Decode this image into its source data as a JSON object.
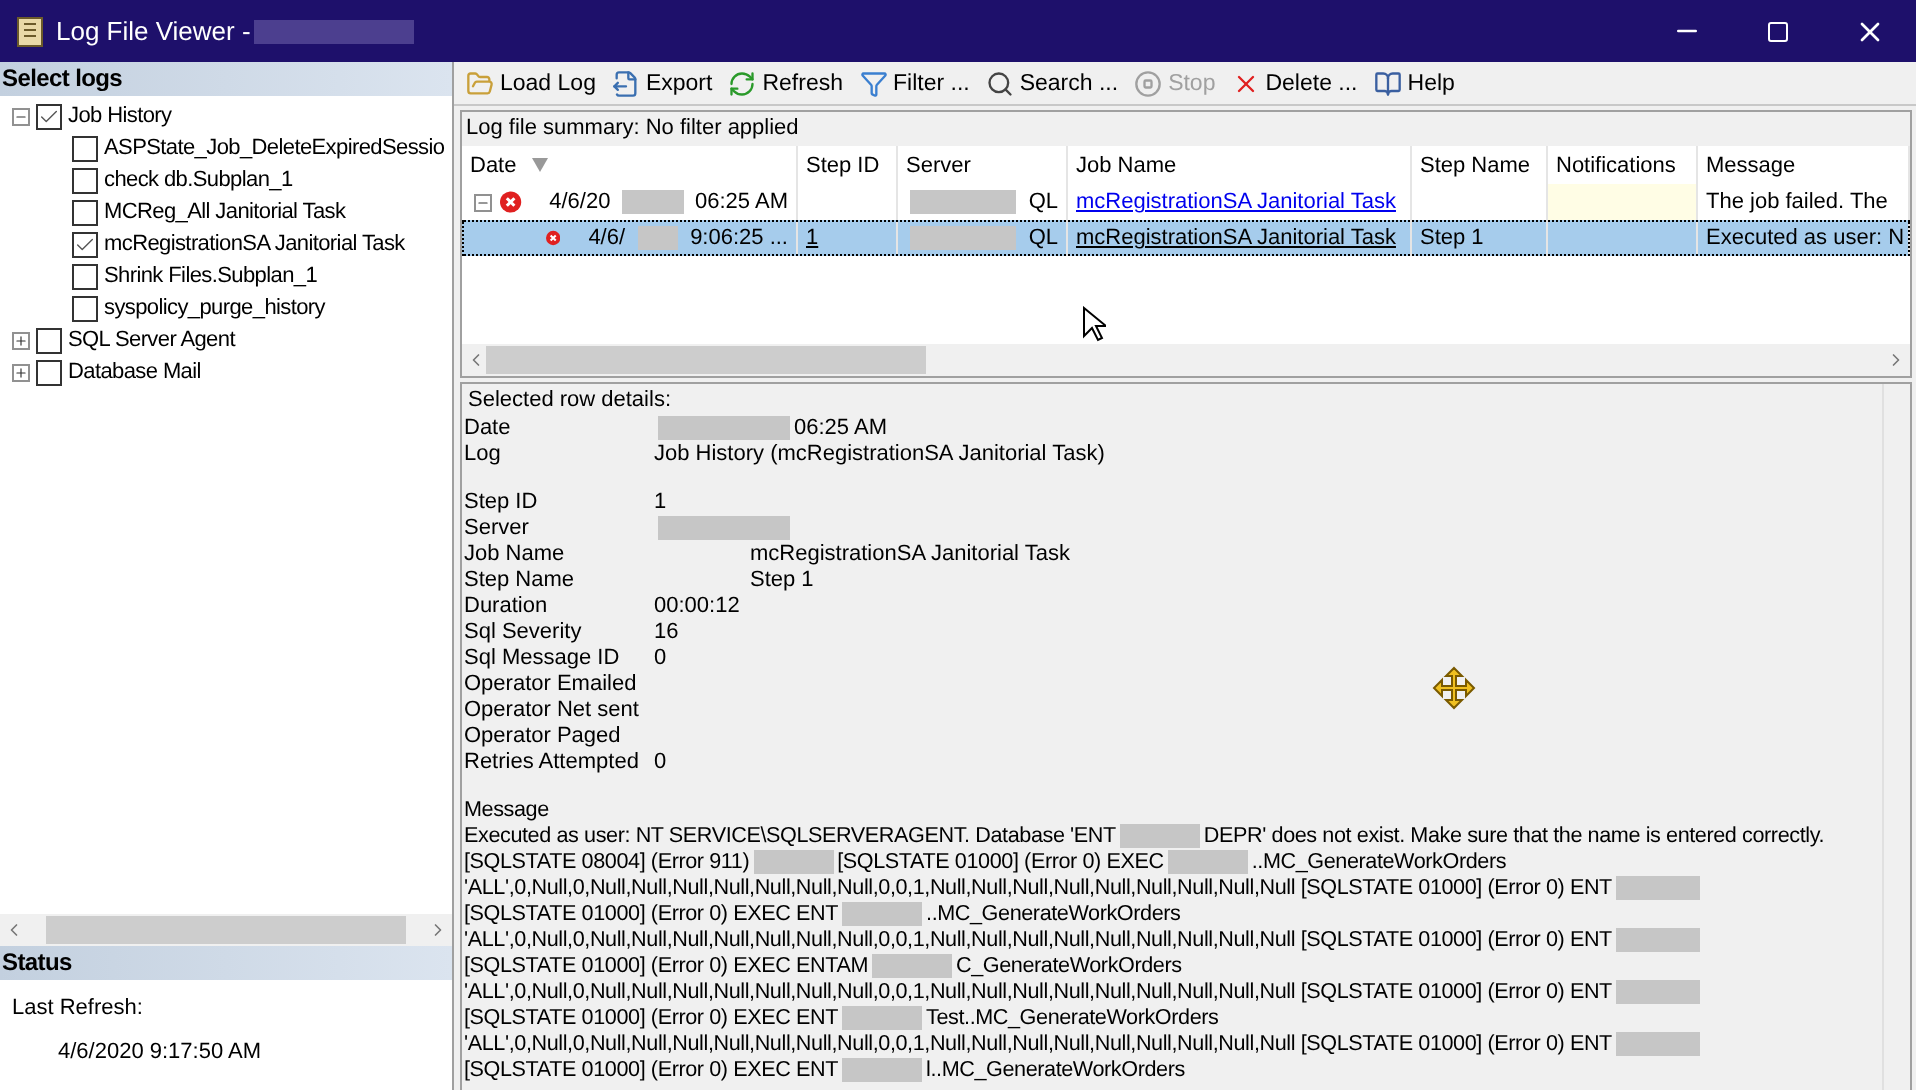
{
  "window": {
    "title": "Log File Viewer -",
    "title_redacted": true
  },
  "sidebar": {
    "header": "Select logs",
    "tree": [
      {
        "label": "Job History",
        "checked": true,
        "expanded": true,
        "children": [
          {
            "label": "ASPState_Job_DeleteExpiredSessio",
            "checked": false
          },
          {
            "label": "check db.Subplan_1",
            "checked": false
          },
          {
            "label": "MCReg_All Janitorial Task",
            "checked": false
          },
          {
            "label": "mcRegistrationSA Janitorial Task",
            "checked": true
          },
          {
            "label": "Shrink Files.Subplan_1",
            "checked": false
          },
          {
            "label": "syspolicy_purge_history",
            "checked": false
          }
        ]
      },
      {
        "label": "SQL Server Agent",
        "checked": false,
        "expanded": false
      },
      {
        "label": "Database Mail",
        "checked": false,
        "expanded": false
      }
    ],
    "status_header": "Status",
    "last_refresh_label": "Last Refresh:",
    "last_refresh_value": "4/6/2020 9:17:50 AM"
  },
  "toolbar": [
    {
      "kind": "folder",
      "label": "Load Log",
      "disabled": false
    },
    {
      "kind": "export",
      "label": "Export",
      "disabled": false
    },
    {
      "kind": "refresh",
      "label": "Refresh",
      "disabled": false
    },
    {
      "kind": "filter",
      "label": "Filter ...",
      "disabled": false
    },
    {
      "kind": "search",
      "label": "Search ...",
      "disabled": false
    },
    {
      "kind": "stop",
      "label": "Stop",
      "disabled": true
    },
    {
      "kind": "delete",
      "label": "Delete ...",
      "disabled": false
    },
    {
      "kind": "help",
      "label": "Help",
      "disabled": false
    }
  ],
  "summary": {
    "title": "Log file summary: No filter applied",
    "columns": [
      "Date",
      "Step ID",
      "Server",
      "Job Name",
      "Step Name",
      "Notifications",
      "Message"
    ],
    "rows": [
      {
        "kind": "job",
        "selected": false,
        "expanded": true,
        "date": [
          "4/6/20",
          "06:25 AM"
        ],
        "step_id": "",
        "server": [
          "QL"
        ],
        "job_name": "mcRegistrationSA Janitorial Task",
        "step_name": "",
        "message": "The job failed.  The"
      },
      {
        "kind": "step",
        "selected": true,
        "date": [
          "4/6/",
          "9:06:25 ..."
        ],
        "step_id": "1",
        "server": [
          "QL"
        ],
        "job_name": "mcRegistrationSA Janitorial Task",
        "step_name": "Step 1",
        "message": "Executed as user: N"
      }
    ]
  },
  "details": {
    "title": "Selected row details:",
    "fields": [
      {
        "label": "Date",
        "value": [
          "06:25 AM"
        ],
        "redacted_start": true
      },
      {
        "label": "Log",
        "value": [
          "Job History (mcRegistrationSA Janitorial Task)"
        ],
        "gap_after": true
      },
      {
        "label": "Step ID",
        "value": [
          "1"
        ]
      },
      {
        "label": "Server",
        "redacted_start": true
      },
      {
        "label": "Job Name",
        "value": [
          "mcRegistrationSA Janitorial Task"
        ],
        "indented": true
      },
      {
        "label": "Step Name",
        "value": [
          "Step 1"
        ],
        "indented": true
      },
      {
        "label": "Duration",
        "value": [
          "00:00:12"
        ]
      },
      {
        "label": "Sql Severity",
        "value": [
          "16"
        ]
      },
      {
        "label": "Sql Message ID",
        "value": [
          "0"
        ]
      },
      {
        "label": "Operator Emailed"
      },
      {
        "label": "Operator Net sent"
      },
      {
        "label": "Operator Paged"
      },
      {
        "label": "Retries Attempted",
        "value": [
          "0"
        ],
        "gap_after": true
      }
    ],
    "message_label": "Message",
    "message_lines": [
      {
        "parts": [
          "Executed as user: NT SERVICE\\SQLSERVERAGENT. Database 'ENT",
          "DEPR' does not exist. Make sure that the name is entered correctly."
        ],
        "redacted_end": false
      },
      {
        "parts": [
          "[SQLSTATE 08004] (Error 911)",
          "[SQLSTATE 01000] (Error 0)  EXEC",
          "..MC_GenerateWorkOrders"
        ],
        "redacted_end": false
      },
      {
        "parts": [
          "'ALL',0,Null,0,Null,Null,Null,Null,Null,Null,Null,0,0,1,Null,Null,Null,Null,Null,Null,Null,Null,Null [SQLSTATE 01000] (Error 0)  ENT"
        ],
        "redacted_end": true
      },
      {
        "parts": [
          "[SQLSTATE 01000] (Error 0)  EXEC ENT",
          "..MC_GenerateWorkOrders"
        ],
        "redacted_end": false
      },
      {
        "parts": [
          "'ALL',0,Null,0,Null,Null,Null,Null,Null,Null,Null,0,0,1,Null,Null,Null,Null,Null,Null,Null,Null,Null [SQLSTATE 01000] (Error 0)  ENT"
        ],
        "redacted_end": true
      },
      {
        "parts": [
          "[SQLSTATE 01000] (Error 0)  EXEC ENTAM",
          "C_GenerateWorkOrders"
        ],
        "redacted_end": false
      },
      {
        "parts": [
          "'ALL',0,Null,0,Null,Null,Null,Null,Null,Null,Null,0,0,1,Null,Null,Null,Null,Null,Null,Null,Null,Null [SQLSTATE 01000] (Error 0)  ENT"
        ],
        "redacted_end": true
      },
      {
        "parts": [
          "[SQLSTATE 01000] (Error 0)  EXEC ENT",
          "Test..MC_GenerateWorkOrders"
        ],
        "redacted_end": false
      },
      {
        "parts": [
          "'ALL',0,Null,0,Null,Null,Null,Null,Null,Null,Null,0,0,1,Null,Null,Null,Null,Null,Null,Null,Null,Null [SQLSTATE 01000] (Error 0)  ENT"
        ],
        "redacted_end": true
      },
      {
        "parts": [
          "[SQLSTATE 01000] (Error 0)  EXEC ENT",
          "l..MC_GenerateWorkOrders"
        ],
        "redacted_end": false
      }
    ]
  }
}
